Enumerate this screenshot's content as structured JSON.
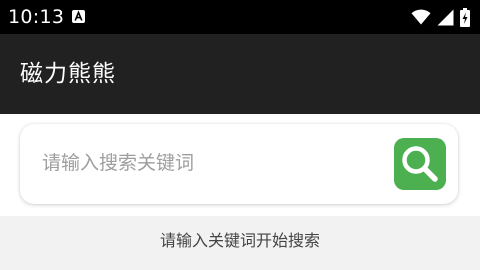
{
  "status_bar": {
    "time": "10:13",
    "notification_icon": "font-a-icon",
    "icons": [
      "wifi-icon",
      "signal-icon",
      "battery-charging-icon"
    ]
  },
  "app_bar": {
    "title": "磁力熊熊",
    "background": "#212121"
  },
  "search": {
    "placeholder": "请输入搜索关键词",
    "value": "",
    "button_icon": "search-icon",
    "button_color": "#4caf50"
  },
  "hint": {
    "text": "请输入关键词开始搜索"
  }
}
